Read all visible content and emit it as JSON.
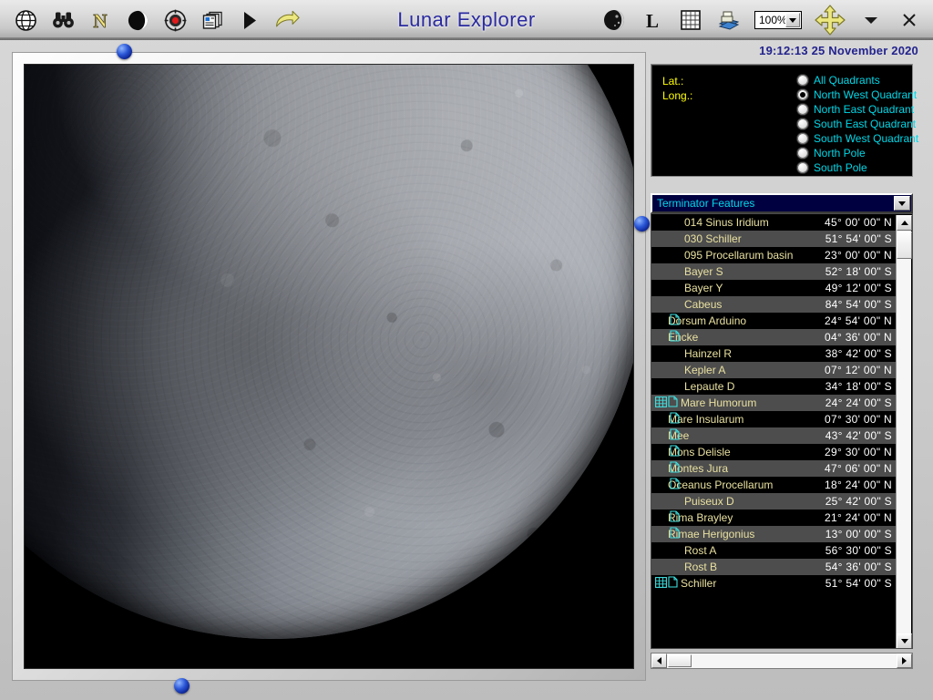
{
  "window": {
    "title": "Lunar Explorer",
    "zoom_level": "100%",
    "close_label": "×"
  },
  "toolbar": {
    "left_icons": [
      {
        "name": "globe-grid-icon",
        "label": "Globe"
      },
      {
        "name": "binoculars-icon",
        "label": "Binoculars"
      },
      {
        "name": "north-letter-icon",
        "label": "N"
      },
      {
        "name": "moon-phase-icon",
        "label": "Phase"
      },
      {
        "name": "target-record-icon",
        "label": "Target"
      },
      {
        "name": "cards-stack-icon",
        "label": "Cards"
      },
      {
        "name": "play-icon",
        "label": "Play"
      },
      {
        "name": "curved-arrow-icon",
        "label": "Redo"
      }
    ],
    "right_icons": [
      {
        "name": "moon-globe-icon",
        "label": "Moon"
      },
      {
        "name": "libration-letter-icon",
        "label": "L"
      },
      {
        "name": "grid-overlay-icon",
        "label": "Grid"
      },
      {
        "name": "print-books-icon",
        "label": "Print"
      }
    ],
    "pan_icon": "four-way-arrow-icon",
    "menu_caret_icon": "chevron-down-icon"
  },
  "status": {
    "time": "19:12:13",
    "date": "25 November 2020",
    "combined": "19:12:13  25 November 2020"
  },
  "coordinates": {
    "lat_label": "Lat.:",
    "long_label": "Long.:",
    "lat_value": "",
    "long_value": ""
  },
  "quadrants": {
    "selected": "North West Quadrant",
    "options": [
      {
        "label": "All Quadrants",
        "selected": false
      },
      {
        "label": "North West Quadrant",
        "selected": true
      },
      {
        "label": "North East Quadrant",
        "selected": false
      },
      {
        "label": "South East Quadrant",
        "selected": false
      },
      {
        "label": "South West Quadrant",
        "selected": false
      },
      {
        "label": "North Pole",
        "selected": false
      },
      {
        "label": "South Pole",
        "selected": false
      }
    ]
  },
  "feature_list": {
    "dropdown_label": "Terminator Features",
    "rows": [
      {
        "name": "014 Sinus Iridium",
        "coord": "45° 00' 00\" N",
        "icons": []
      },
      {
        "name": "030 Schiller",
        "coord": "51° 54' 00\" S",
        "icons": []
      },
      {
        "name": "095 Procellarum basin",
        "coord": "23° 00' 00\" N",
        "icons": []
      },
      {
        "name": "Bayer S",
        "coord": "52° 18' 00\" S",
        "icons": []
      },
      {
        "name": "Bayer Y",
        "coord": "49° 12' 00\" S",
        "icons": []
      },
      {
        "name": "Cabeus",
        "coord": "84° 54' 00\" S",
        "icons": []
      },
      {
        "name": "Dorsum Arduino",
        "coord": "24° 54' 00\" N",
        "icons": [
          "doc"
        ]
      },
      {
        "name": "Encke",
        "coord": "04° 36' 00\" N",
        "icons": [
          "doc"
        ]
      },
      {
        "name": "Hainzel R",
        "coord": "38° 42' 00\" S",
        "icons": []
      },
      {
        "name": "Kepler A",
        "coord": "07° 12' 00\" N",
        "icons": []
      },
      {
        "name": "Lepaute D",
        "coord": "34° 18' 00\" S",
        "icons": []
      },
      {
        "name": "Mare Humorum",
        "coord": "24° 24' 00\" S",
        "icons": [
          "grid",
          "doc"
        ]
      },
      {
        "name": "Mare Insularum",
        "coord": "07° 30' 00\" N",
        "icons": [
          "doc"
        ]
      },
      {
        "name": "Mee",
        "coord": "43° 42' 00\" S",
        "icons": [
          "doc"
        ]
      },
      {
        "name": "Mons Delisle",
        "coord": "29° 30' 00\" N",
        "icons": [
          "doc"
        ]
      },
      {
        "name": "Montes Jura",
        "coord": "47° 06' 00\" N",
        "icons": [
          "doc"
        ]
      },
      {
        "name": "Oceanus Procellarum",
        "coord": "18° 24' 00\" N",
        "icons": [
          "doc"
        ]
      },
      {
        "name": "Puiseux D",
        "coord": "25° 42' 00\" S",
        "icons": []
      },
      {
        "name": "Rima Brayley",
        "coord": "21° 24' 00\" N",
        "icons": [
          "doc"
        ]
      },
      {
        "name": "Rimae Herigonius",
        "coord": "13° 00' 00\" S",
        "icons": [
          "doc"
        ]
      },
      {
        "name": "Rost A",
        "coord": "56° 30' 00\" S",
        "icons": []
      },
      {
        "name": "Rost B",
        "coord": "54° 36' 00\" S",
        "icons": []
      },
      {
        "name": "Schiller",
        "coord": "51° 54' 00\" S",
        "icons": [
          "grid",
          "doc"
        ]
      }
    ]
  },
  "colors": {
    "title_blue": "#2a2aa0",
    "datetime_blue": "#23238e",
    "label_yellow": "#ffff00",
    "radio_cyan": "#00d8e8",
    "row_text": "#e8e0a0",
    "coord_text": "#ffffff",
    "combo_bg": "#000040",
    "row_alt_bg": "#4d4d4d",
    "row_bg": "#000000",
    "icon_cyan": "#3fe0e0",
    "handle_blue": "#2a56d6"
  }
}
